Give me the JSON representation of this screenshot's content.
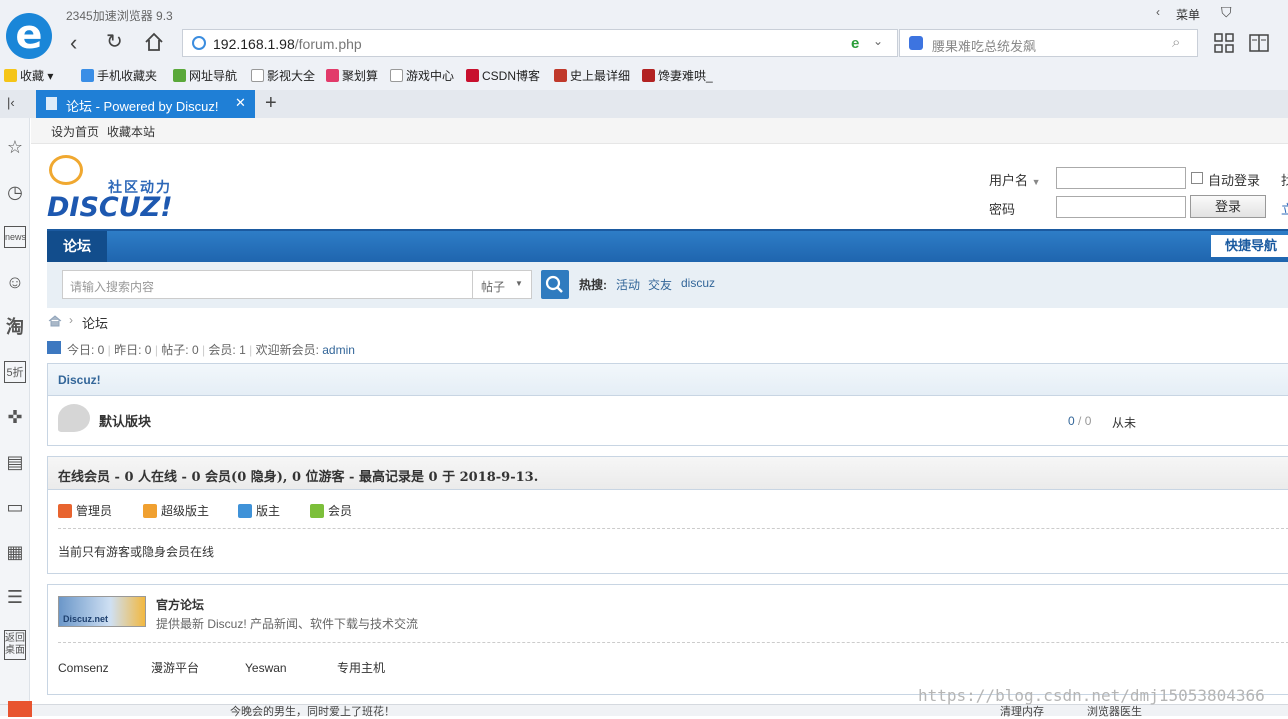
{
  "browser": {
    "app_title": "2345加速浏览器 9.3",
    "menu_label": "菜单",
    "url_host": "192.168.1.98",
    "url_path": "/forum.php",
    "search_placeholder": "腰果难吃总统发飙",
    "bookmarks": [
      "收藏",
      "手机收藏夹",
      "网址导航",
      "影视大全",
      "聚划算",
      "游戏中心",
      "CSDN博客",
      "史上最详细",
      "馋妻难哄_"
    ],
    "tab_title": "论坛 - Powered by Discuz!"
  },
  "sidebar": {
    "back_desktop_label": "返回桌面"
  },
  "site": {
    "top_links": [
      "设为首页",
      "收藏本站"
    ],
    "logo_tagline": "社区动力",
    "logo_text": "DISCUZ!",
    "login": {
      "username_label": "用户名",
      "password_label": "密码",
      "auto_login_label": "自动登录",
      "login_button": "登录",
      "right_cut_1": "找",
      "right_cut_2": "立"
    },
    "nav": {
      "forum_label": "论坛",
      "quick_nav": "快捷导航"
    },
    "search": {
      "placeholder": "请输入搜索内容",
      "type_option": "帖子",
      "hot_label": "热搜:",
      "hot_words": [
        "活动",
        "交友",
        "discuz"
      ]
    },
    "breadcrumb": {
      "current": "论坛"
    },
    "stats": {
      "today": "今日: 0",
      "yesterday": "昨日: 0",
      "posts": "帖子: 0",
      "members": "会员: 1",
      "welcome_prefix": "欢迎新会员:",
      "welcome_user": "admin"
    },
    "category": {
      "name": "Discuz!",
      "forum_name": "默认版块",
      "threads": "0",
      "posts_count": "0",
      "last_post": "从未"
    },
    "online": {
      "title": "在线会员 - 0 人在线 - 0 会员(0 隐身), 0 位游客 - 最高记录是 0 于 2018-9-13.",
      "groups": [
        "管理员",
        "超级版主",
        "版主",
        "会员"
      ],
      "group_colors": [
        "#e8642f",
        "#f0a030",
        "#3f92d8",
        "#7cbf3a"
      ],
      "note": "当前只有游客或隐身会员在线"
    },
    "links": {
      "official_name": "官方论坛",
      "official_desc": "提供最新 Discuz! 产品新闻、软件下载与技术交流",
      "badge_text": "Discuz.net",
      "friends": [
        "Comsenz",
        "漫游平台",
        "Yeswan",
        "专用主机"
      ]
    }
  },
  "footer": {
    "news_text": "今晚会的男生，同时爱上了班花！",
    "cleanup": "清理内存",
    "doctor": "浏览器医生",
    "watermark": "https://blog.csdn.net/dmj15053804366"
  }
}
